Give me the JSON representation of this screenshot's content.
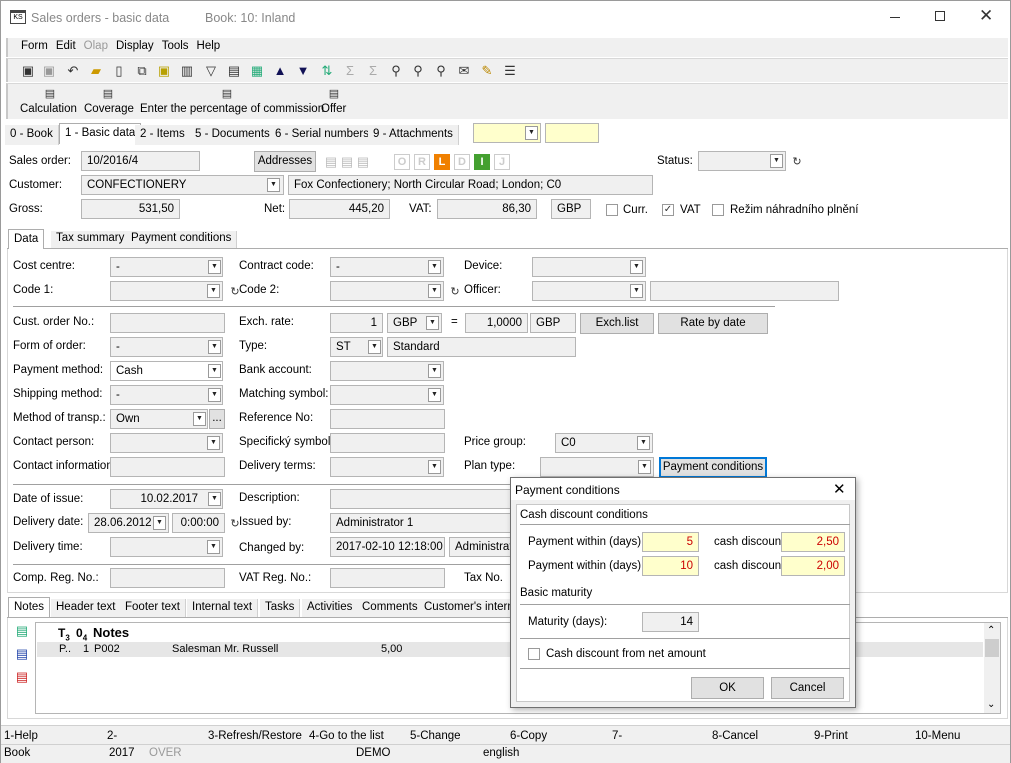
{
  "window": {
    "title": "Sales orders - basic data",
    "book": "Book: 10: Inland"
  },
  "menu": [
    "Form",
    "Edit",
    "Olap",
    "Display",
    "Tools",
    "Help"
  ],
  "toolbar2": {
    "calculation": "Calculation",
    "coverage": "Coverage",
    "commission": "Enter the percentage of commission",
    "offer": "Offer"
  },
  "tabs": [
    "0 - Book",
    "1 - Basic data",
    "2 - Items",
    "5 - Documents",
    "6 - Serial numbers",
    "9 - Attachments"
  ],
  "header": {
    "sales_order_label": "Sales order:",
    "sales_order": "10/2016/4",
    "addresses": "Addresses",
    "status_label": "Status:",
    "letters": [
      "O",
      "R",
      "L",
      "D",
      "I",
      "J"
    ],
    "customer_label": "Customer:",
    "customer": "CONFECTIONERY",
    "customer_address": "Fox Confectionery; North Circular Road; London; C0",
    "gross_label": "Gross:",
    "gross": "531,50",
    "net_label": "Net:",
    "net": "445,20",
    "vat_label": "VAT:",
    "vat": "86,30",
    "currency": "GBP",
    "curr_label": "Curr.",
    "vat_check_label": "VAT",
    "rezim_label": "Režim náhradního plnění"
  },
  "subtabs": [
    "Data",
    "Tax summary",
    "Payment conditions"
  ],
  "form": {
    "cost_centre_label": "Cost centre:",
    "cost_centre": "-",
    "contract_code_label": "Contract code:",
    "contract_code": "-",
    "device_label": "Device:",
    "code1_label": "Code 1:",
    "code2_label": "Code 2:",
    "officer_label": "Officer:",
    "cust_order_label": "Cust. order No.:",
    "exch_rate_label": "Exch. rate:",
    "exch_qty": "1",
    "exch_cur": "GBP",
    "exch_eq": "=",
    "exch_val": "1,0000",
    "exch_cur2": "GBP",
    "exch_list": "Exch.list",
    "rate_by_date": "Rate by date",
    "form_of_order_label": "Form of order:",
    "form_of_order": "-",
    "type_label": "Type:",
    "type_code": "ST",
    "type_name": "Standard",
    "payment_method_label": "Payment method:",
    "payment_method": "Cash",
    "bank_account_label": "Bank account:",
    "shipping_method_label": "Shipping method:",
    "shipping_method": "-",
    "matching_symbol_label": "Matching symbol:",
    "transport_label": "Method of transp.:",
    "transport": "Own",
    "ellipsis": "...",
    "reference_label": "Reference No:",
    "contact_person_label": "Contact person:",
    "specific_symbol_label": "Specifický symbol:",
    "price_group_label": "Price group:",
    "price_group": "C0",
    "contact_info_label": "Contact information",
    "delivery_terms_label": "Delivery terms:",
    "plan_type_label": "Plan type:",
    "payment_conditions_btn": "Payment conditions",
    "date_of_issue_label": "Date of issue:",
    "date_of_issue": "10.02.2017",
    "description_label": "Description:",
    "delivery_date_label": "Delivery date:",
    "delivery_date": "28.06.2012",
    "delivery_time_val": "0:00:00",
    "issued_by_label": "Issued by:",
    "issued_by": "Administrator 1",
    "delivery_time_label": "Delivery time:",
    "changed_by_label": "Changed by:",
    "changed_at": "2017-02-10 12:18:00",
    "changed_by": "Administrato",
    "comp_reg_label": "Comp. Reg. No.:",
    "vat_reg_label": "VAT Reg. No.:",
    "tax_no_label": "Tax No."
  },
  "notes_tabs": [
    "Notes",
    "Header text",
    "Footer text",
    "Internal text",
    "Tasks",
    "Activities",
    "Comments",
    "Customer's interna"
  ],
  "notes": {
    "headers": [
      "T",
      "3",
      "0",
      "4",
      "Notes"
    ],
    "row": {
      "c1": "P..",
      "c2": "1",
      "c3": "P002",
      "c4": "Salesman Mr. Russell",
      "c5": "5,00"
    }
  },
  "dialog": {
    "title": "Payment conditions",
    "group1": "Cash discount conditions",
    "pay_within_label": "Payment within (days):",
    "row1_days": "5",
    "row1_disc": "2,50",
    "row2_days": "10",
    "row2_disc": "2,00",
    "cash_discount_label": "cash discount",
    "group2": "Basic maturity",
    "maturity_label": "Maturity (days):",
    "maturity": "14",
    "net_amount_label": "Cash discount from net amount",
    "ok": "OK",
    "cancel": "Cancel"
  },
  "fkeys": [
    "1-Help",
    "2-",
    "3-Refresh/Restore",
    "4-Go to the list",
    "5-Change",
    "6-Copy",
    "7-",
    "8-Cancel",
    "9-Print",
    "10-Menu"
  ],
  "status": {
    "book": "Book",
    "year": "2017",
    "over": "OVER",
    "demo": "DEMO",
    "lang": "english"
  }
}
